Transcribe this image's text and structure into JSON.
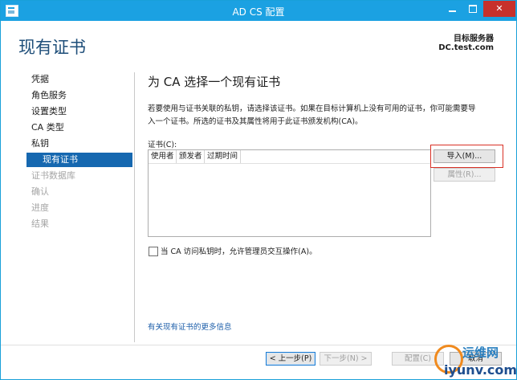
{
  "window": {
    "title": "AD CS 配置",
    "controls": {
      "minimize": "—",
      "maximize": "□",
      "close": "✕"
    }
  },
  "header": {
    "page_title": "现有证书",
    "server_label": "目标服务器",
    "server_name": "DC.test.com"
  },
  "nav": {
    "items": [
      {
        "label": "凭据",
        "state": "normal"
      },
      {
        "label": "角色服务",
        "state": "normal"
      },
      {
        "label": "设置类型",
        "state": "normal"
      },
      {
        "label": "CA 类型",
        "state": "normal"
      },
      {
        "label": "私钥",
        "state": "normal"
      },
      {
        "label": "现有证书",
        "state": "selected"
      },
      {
        "label": "证书数据库",
        "state": "disabled"
      },
      {
        "label": "确认",
        "state": "disabled"
      },
      {
        "label": "进度",
        "state": "disabled"
      },
      {
        "label": "结果",
        "state": "disabled"
      }
    ]
  },
  "main": {
    "title": "为 CA 选择一个现有证书",
    "description_line1": "若要使用与证书关联的私钥，请选择该证书。如果在目标计算机上没有可用的证书，你可能需要导",
    "description_line2": "入一个证书。所选的证书及其属性将用于此证书颁发机构(CA)。",
    "cert_label": "证书(C):",
    "columns": [
      "使用者",
      "颁发者",
      "过期时间"
    ],
    "import_button": "导入(M)...",
    "properties_button": "属性(R)...",
    "checkbox_label": "当 CA 访问私钥时，允许管理员交互操作(A)。",
    "more_info_link": "有关现有证书的更多信息"
  },
  "footer": {
    "back": "< 上一步(P)",
    "next": "下一步(N) >",
    "configure": "配置(C)",
    "cancel": "取消"
  },
  "watermark": {
    "top": "运维网",
    "bottom": "iyunv.com"
  },
  "colors": {
    "titlebar": "#1ba1e2",
    "nav_selected": "#1668b0",
    "heading": "#1e4e79",
    "highlight": "#d93025"
  }
}
